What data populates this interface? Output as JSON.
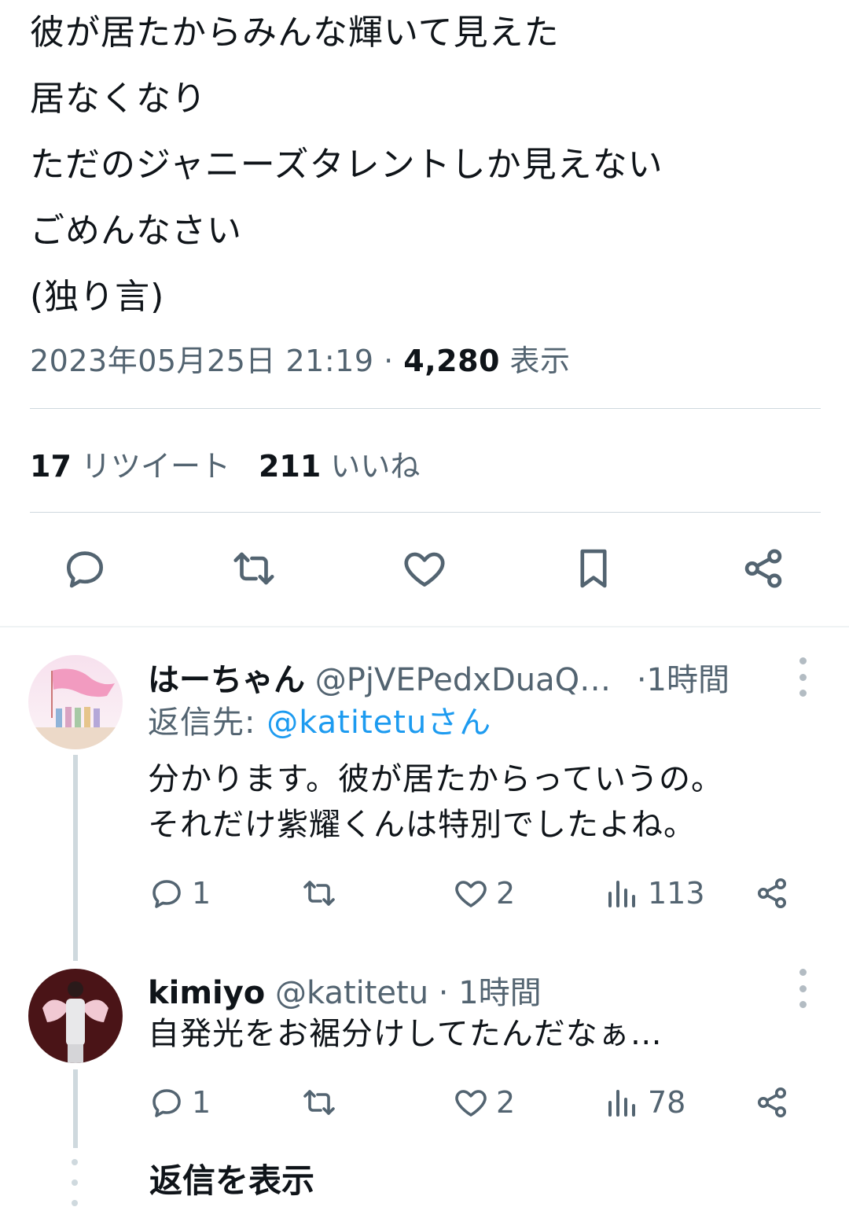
{
  "tweet": {
    "lines": [
      "彼が居たからみんな輝いて見えた",
      "居なくなり",
      "ただのジャニーズタレントしか見えない",
      "ごめんなさい",
      "(独り言)"
    ],
    "timestamp": "2023年05月25日 21:19 · ",
    "views_count": "4,280",
    "views_label": " 表示",
    "retweets_count": "17",
    "retweets_label": " リツイート",
    "likes_count": "211",
    "likes_label": " いいね"
  },
  "actions": {
    "icons": [
      "reply-icon",
      "retweet-icon",
      "like-icon",
      "bookmark-icon",
      "share-icon"
    ]
  },
  "replies": [
    {
      "name": "はーちゃん",
      "handle": " @PjVEPedxDuaQ…",
      "time": " ·1時間",
      "reply_to_label": "返信先: ",
      "reply_to_mention": "@katitetuさん",
      "lines": [
        "分かります。彼が居たからっていうの。",
        "それだけ紫耀くんは特別でしたよね。"
      ],
      "reply_count": "1",
      "retweet_count": "",
      "like_count": "2",
      "views": "113"
    },
    {
      "name": "kimiyo",
      "handle": " @katitetu",
      "time": " · 1時間",
      "lines": [
        "自発光をお裾分けしてたんだなぁ…"
      ],
      "reply_count": "1",
      "retweet_count": "",
      "like_count": "2",
      "views": "78"
    }
  ],
  "show_replies_label": "返信を表示",
  "colors": {
    "text": "#0f1419",
    "secondary": "#536471",
    "divider": "#cfd9de",
    "accent": "#1d9bf0"
  }
}
